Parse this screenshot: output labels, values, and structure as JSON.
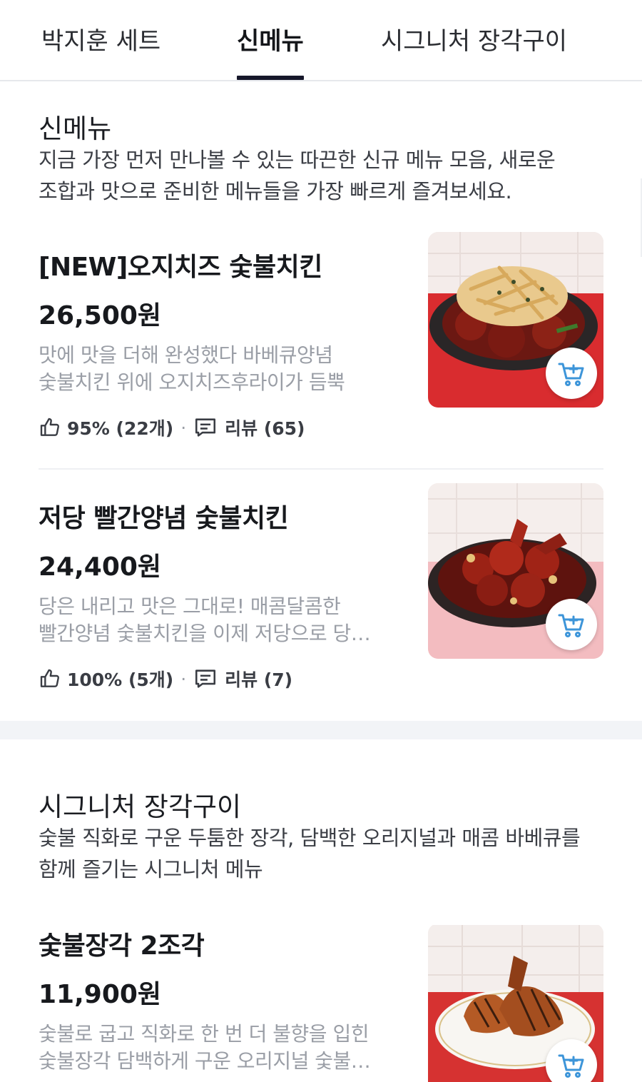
{
  "tabs": [
    {
      "label": "박지훈 세트",
      "active": false
    },
    {
      "label": "신메뉴",
      "active": true
    },
    {
      "label": "시그니처 장각구이",
      "active": false
    }
  ],
  "sections": [
    {
      "title": "신메뉴",
      "desc_lines": [
        "지금 가장 먼저 만나볼 수 있는 따끈한 신규 메뉴 모음, 새로운",
        "조합과 맛으로 준비한 메뉴들을 가장 빠르게 즐겨보세요."
      ],
      "items": [
        {
          "name": "[NEW]오지치즈 숯불치킨",
          "price": "26,500원",
          "desc_lines": [
            "맛에 맛을 더해 완성했다 바베큐양념",
            "숯불치킨 위에 오지치즈후라이가 듬뿍"
          ],
          "like": "95% (22개)",
          "review": "리뷰 (65)"
        },
        {
          "name": "저당 빨간양념 숯불치킨",
          "price": "24,400원",
          "desc_lines": [
            "당은 내리고 맛은 그대로! 매콤달콤한",
            "빨간양념 숯불치킨을 이제 저당으로 당…"
          ],
          "like": "100% (5개)",
          "review": "리뷰 (7)"
        }
      ]
    },
    {
      "title": "시그니처 장각구이",
      "desc_lines": [
        "숯불 직화로 구운 두툼한 장각, 담백한 오리지널과 매콤 바베큐를",
        "함께 즐기는 시그니처 메뉴"
      ],
      "items": [
        {
          "name": "숯불장각 2조각",
          "price": "11,900원",
          "desc_lines": [
            "숯불로 굽고 직화로 한 번 더 불향을 입힌",
            "숯불장각 담백하게 구운 오리지널 숯불…"
          ]
        }
      ]
    }
  ],
  "icons": {
    "like": "thumbs-up-icon",
    "review": "comment-icon",
    "cart": "cart-add-icon"
  },
  "colors": {
    "accent": "#3d95d9",
    "text": "#17191d",
    "muted": "#9a9ea6",
    "tab_underline": "#16172a"
  }
}
